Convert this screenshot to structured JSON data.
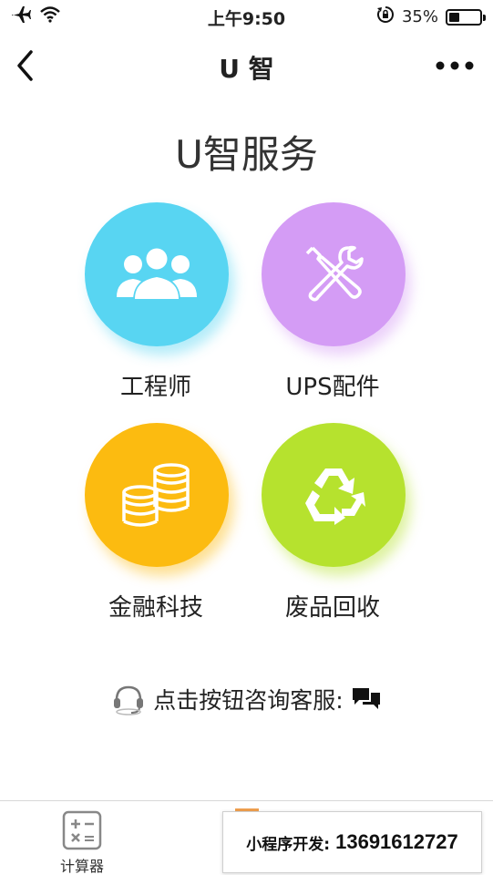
{
  "status_bar": {
    "time": "上午9:50",
    "battery_text": "35%",
    "battery_level": 0.35,
    "icons": [
      "airplane-icon",
      "wifi-icon",
      "orientation-lock-icon",
      "battery-icon"
    ]
  },
  "nav": {
    "title": "U 智",
    "back_icon": "chevron-left-icon",
    "more_icon": "more-dots-icon"
  },
  "page": {
    "title": "U智服务"
  },
  "services": [
    {
      "label": "工程师",
      "icon": "people-group-icon",
      "color": "#58d5f2"
    },
    {
      "label": "UPS配件",
      "icon": "tools-icon",
      "color": "#d49cf5"
    },
    {
      "label": "金融科技",
      "icon": "coins-icon",
      "color": "#fcbb10"
    },
    {
      "label": "废品回收",
      "icon": "recycle-icon",
      "color": "#b6e22e"
    }
  ],
  "contact": {
    "text": "点击按钮咨询客服:",
    "left_icon": "headset-icon",
    "right_icon": "chat-bubbles-icon"
  },
  "tab_bar": {
    "calculator_label": "计算器",
    "calculator_icon": "calculator-icon"
  },
  "dev_banner": {
    "label": "小程序开发:",
    "phone": "13691612727"
  }
}
